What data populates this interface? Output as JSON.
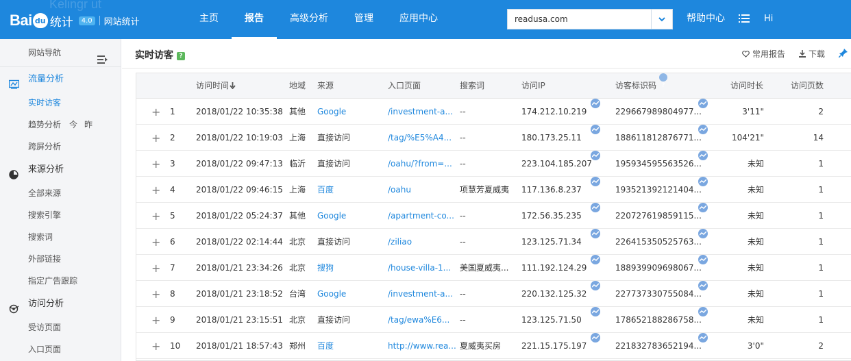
{
  "header": {
    "logo_bai": "Bai",
    "logo_paw": "du",
    "logo_stat": "统计",
    "version": "4.0",
    "site_label": "网站统计",
    "ghost_text": "Kelingr ut",
    "nav": [
      {
        "label": "主页",
        "active": false
      },
      {
        "label": "报告",
        "active": true
      },
      {
        "label": "高级分析",
        "active": false
      },
      {
        "label": "管理",
        "active": false
      },
      {
        "label": "应用中心",
        "active": false
      }
    ],
    "domain": "readusa.com",
    "help": "帮助中心",
    "greeting": "Hi"
  },
  "sidebar": {
    "title": "网站导航",
    "groups": [
      {
        "label": "流量分析",
        "active": true,
        "icon": "chart-icon",
        "items": [
          {
            "label": "实时访客",
            "active": true,
            "extras": []
          },
          {
            "label": "趋势分析",
            "active": false,
            "extras": [
              "今",
              "昨"
            ]
          },
          {
            "label": "跨屏分析",
            "active": false,
            "extras": []
          }
        ]
      },
      {
        "label": "来源分析",
        "active": false,
        "icon": "pie-icon",
        "items": [
          {
            "label": "全部来源",
            "active": false,
            "extras": []
          },
          {
            "label": "搜索引擎",
            "active": false,
            "extras": []
          },
          {
            "label": "搜索词",
            "active": false,
            "extras": []
          },
          {
            "label": "外部链接",
            "active": false,
            "extras": []
          },
          {
            "label": "指定广告跟踪",
            "active": false,
            "extras": []
          }
        ]
      },
      {
        "label": "访问分析",
        "active": false,
        "icon": "visit-icon",
        "items": [
          {
            "label": "受访页面",
            "active": false,
            "extras": []
          },
          {
            "label": "入口页面",
            "active": false,
            "extras": []
          }
        ]
      }
    ]
  },
  "page": {
    "title": "实时访客",
    "help_badge": "?",
    "actions": {
      "common_report": "常用报告",
      "download": "下载"
    }
  },
  "table": {
    "columns": {
      "time": "访问时间",
      "region": "地域",
      "source": "来源",
      "entry": "入口页面",
      "keyword": "搜索词",
      "ip": "访问IP",
      "visitor_id": "访客标识码",
      "duration": "访问时长",
      "pages": "访问页数"
    },
    "rows": [
      {
        "no": "1",
        "time": "2018/01/22 10:35:38",
        "region": "其他",
        "source": "Google",
        "source_link": true,
        "entry": "/investment-a...",
        "keyword": "--",
        "ip": "174.212.10.219",
        "vid": "229667989804977...",
        "duration": "3'11\"",
        "pages": "2"
      },
      {
        "no": "2",
        "time": "2018/01/22 10:19:03",
        "region": "上海",
        "source": "直接访问",
        "source_link": false,
        "entry": "/tag/%E5%A4...",
        "keyword": "--",
        "ip": "180.173.25.11",
        "vid": "188611812876771...",
        "duration": "104'21\"",
        "pages": "14"
      },
      {
        "no": "3",
        "time": "2018/01/22 09:47:13",
        "region": "临沂",
        "source": "直接访问",
        "source_link": false,
        "entry": "/oahu/?from=...",
        "keyword": "--",
        "ip": "223.104.185.207",
        "vid": "195934595563526...",
        "duration": "未知",
        "pages": "1"
      },
      {
        "no": "4",
        "time": "2018/01/22 09:46:15",
        "region": "上海",
        "source": "百度",
        "source_link": true,
        "entry": "/oahu",
        "keyword": "项慧芳夏威夷",
        "ip": "117.136.8.237",
        "vid": "193521392121404...",
        "duration": "未知",
        "pages": "1"
      },
      {
        "no": "5",
        "time": "2018/01/22 05:24:37",
        "region": "其他",
        "source": "Google",
        "source_link": true,
        "entry": "/apartment-co...",
        "keyword": "--",
        "ip": "172.56.35.235",
        "vid": "220727619859115...",
        "duration": "未知",
        "pages": "1"
      },
      {
        "no": "6",
        "time": "2018/01/22 02:14:44",
        "region": "北京",
        "source": "直接访问",
        "source_link": false,
        "entry": "/ziliao",
        "keyword": "--",
        "ip": "123.125.71.34",
        "vid": "226415350525763...",
        "duration": "未知",
        "pages": "1"
      },
      {
        "no": "7",
        "time": "2018/01/21 23:34:26",
        "region": "北京",
        "source": "搜狗",
        "source_link": true,
        "entry": "/house-villa-1...",
        "keyword": "美国夏威夷...",
        "ip": "111.192.124.29",
        "vid": "188939909698067...",
        "duration": "未知",
        "pages": "1"
      },
      {
        "no": "8",
        "time": "2018/01/21 23:18:52",
        "region": "台湾",
        "source": "Google",
        "source_link": true,
        "entry": "/investment-a...",
        "keyword": "--",
        "ip": "220.132.125.32",
        "vid": "227737330755084...",
        "duration": "未知",
        "pages": "1"
      },
      {
        "no": "9",
        "time": "2018/01/21 23:15:51",
        "region": "北京",
        "source": "直接访问",
        "source_link": false,
        "entry": "/tag/ewa%E6...",
        "keyword": "--",
        "ip": "123.125.71.50",
        "vid": "178652188286758...",
        "duration": "未知",
        "pages": "1"
      },
      {
        "no": "10",
        "time": "2018/01/21 18:57:43",
        "region": "郑州",
        "source": "百度",
        "source_link": true,
        "entry": "http://www.rea...",
        "keyword": "夏威夷买房",
        "ip": "221.15.175.197",
        "vid": "221832783652194...",
        "duration": "3'0\"",
        "pages": "2"
      }
    ]
  },
  "colors": {
    "brand": "#1e87dd",
    "sidebar_bg": "#f4f5f7",
    "header_row_bg": "#f5f6f8"
  }
}
